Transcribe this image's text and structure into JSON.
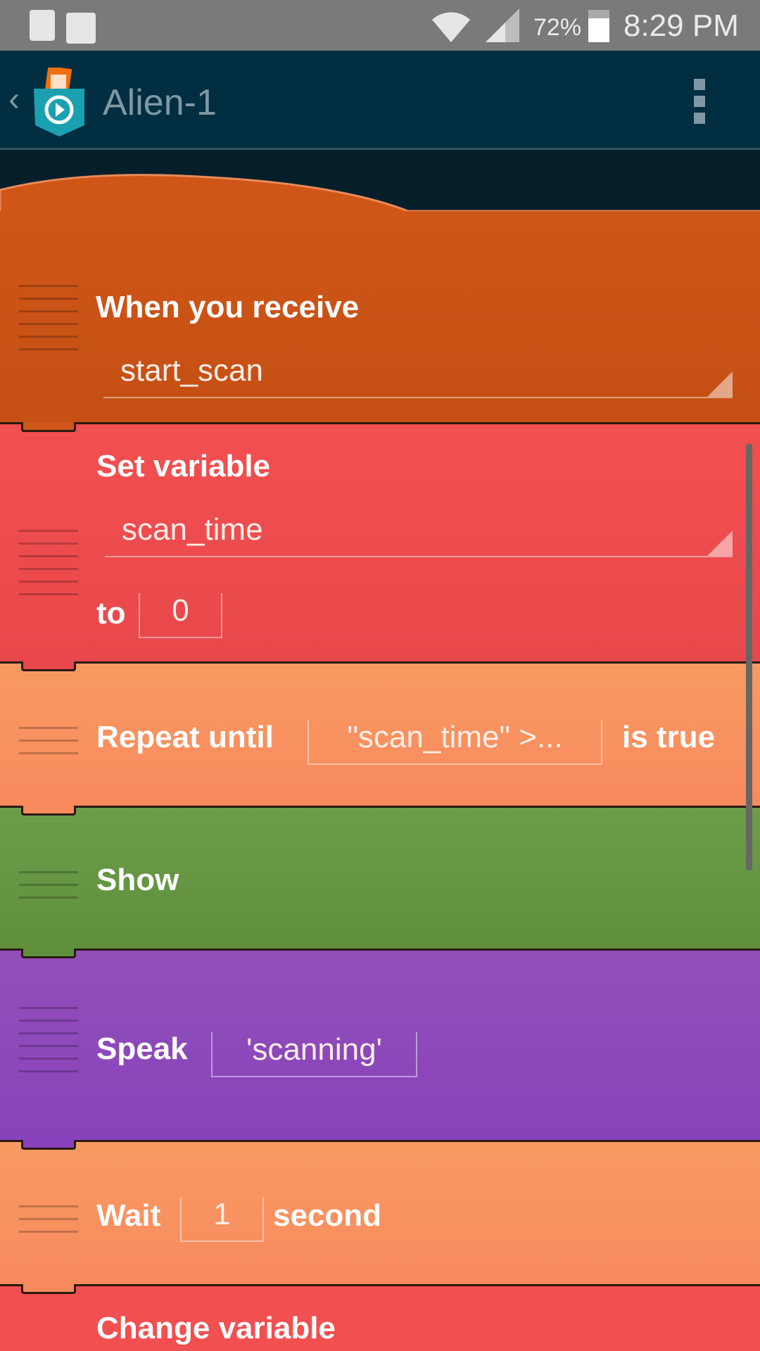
{
  "status_bar": {
    "battery_percent": "72%",
    "time": "8:29 PM",
    "icons": [
      "recycle-battery-icon",
      "briefcase-check-icon",
      "wifi-icon",
      "signal-icon",
      "battery-icon"
    ]
  },
  "action_bar": {
    "title": "Alien-1",
    "back_icon": "chevron-left-icon",
    "logo": "pocket-code-logo",
    "menu_icon": "overflow-menu-icon"
  },
  "colors": {
    "when_receive": "#cf5617",
    "set_variable": "#f24f50",
    "repeat": "#f8965f",
    "show": "#6a9b48",
    "speak": "#8e4db8",
    "wait": "#f8965f",
    "change_variable": "#f24f50"
  },
  "blocks": {
    "when_receive": {
      "label": "When you receive",
      "message": "start_scan"
    },
    "set_variable": {
      "label": "Set variable",
      "variable": "scan_time",
      "to_label": "to",
      "value": "0"
    },
    "repeat_until": {
      "label": "Repeat until",
      "condition": "\"scan_time\" >...",
      "suffix": "is true"
    },
    "show": {
      "label": "Show"
    },
    "speak": {
      "label": "Speak",
      "text": "'scanning'"
    },
    "wait": {
      "label": "Wait",
      "value": "1",
      "unit": "second"
    },
    "change_variable": {
      "label": "Change variable"
    }
  }
}
